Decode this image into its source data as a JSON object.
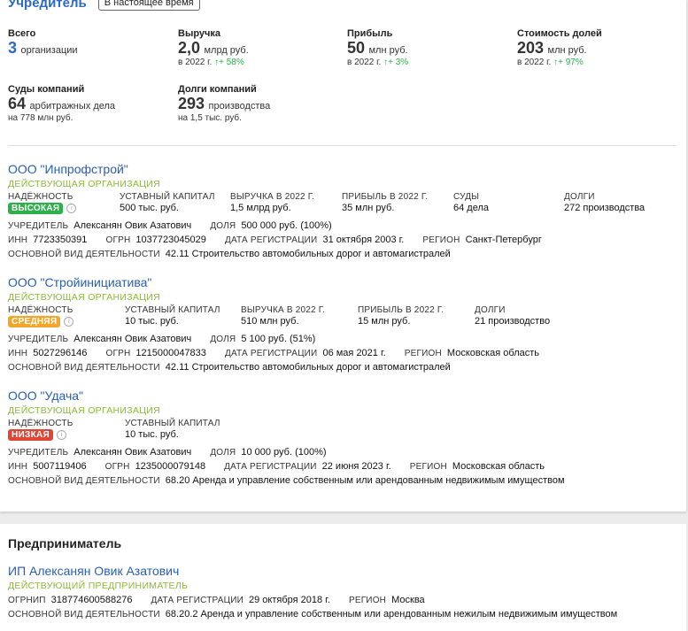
{
  "founder": {
    "title": "Учредитель",
    "badge": "В настоящее время",
    "stats": {
      "total": {
        "label": "Всего",
        "value": "3",
        "unit": "организации"
      },
      "revenue": {
        "label": "Выручка",
        "value": "2,0",
        "unit": "млрд руб.",
        "year": "в 2022 г.",
        "growth": "+ 58%"
      },
      "profit": {
        "label": "Прибыль",
        "value": "50",
        "unit": "млн руб.",
        "year": "в 2022 г.",
        "growth": "+ 3%"
      },
      "shares": {
        "label": "Стоимость долей",
        "value": "203",
        "unit": "млн руб.",
        "year": "в 2022 г.",
        "growth": "+ 97%"
      },
      "courts": {
        "label": "Суды компаний",
        "value": "64",
        "unit": "арбитражных дела",
        "sub": "на 778 млн руб."
      },
      "debts": {
        "label": "Долги компаний",
        "value": "293",
        "unit": "производства",
        "sub": "на 1,5 тыс. руб."
      }
    },
    "orgs": [
      {
        "name": "ООО \"Инпрофстрой\"",
        "status": "ДЕЙСТВУЮЩАЯ ОРГАНИЗАЦИЯ",
        "reliability_label": "НАДЁЖНОСТЬ",
        "reliability": "ВЫСОКАЯ",
        "capital_label": "УСТАВНЫЙ КАПИТАЛ",
        "capital": "500 тыс. руб.",
        "revenue_label": "ВЫРУЧКА В 2022 Г.",
        "revenue": "1,5 млрд руб.",
        "profit_label": "ПРИБЫЛЬ В 2022 Г.",
        "profit": "35 млн руб.",
        "courts_label": "СУДЫ",
        "courts": "64 дела",
        "debts_label": "ДОЛГИ",
        "debts": "272 производства",
        "founder_label": "УЧРЕДИТЕЛЬ",
        "founder": "Алексанян Овик Азатович",
        "share_label": "ДОЛЯ",
        "share": "500 000 руб. (100%)",
        "inn_label": "ИНН",
        "inn": "7723350391",
        "ogrn_label": "ОГРН",
        "ogrn": "1037723045029",
        "reg_label": "ДАТА РЕГИСТРАЦИИ",
        "reg": "31 октября 2003 г.",
        "region_label": "РЕГИОН",
        "region": "Санкт-Петербург",
        "activity_label": "ОСНОВНОЙ ВИД ДЕЯТЕЛЬНОСТИ",
        "activity": "42.11 Строительство автомобильных дорог и автомагистралей"
      },
      {
        "name": "ООО \"Стройинициатива\"",
        "status": "ДЕЙСТВУЮЩАЯ ОРГАНИЗАЦИЯ",
        "reliability_label": "НАДЁЖНОСТЬ",
        "reliability": "СРЕДНЯЯ",
        "capital_label": "УСТАВНЫЙ КАПИТАЛ",
        "capital": "10 тыс. руб.",
        "revenue_label": "ВЫРУЧКА В 2022 Г.",
        "revenue": "510 млн руб.",
        "profit_label": "ПРИБЫЛЬ В 2022 Г.",
        "profit": "15 млн руб.",
        "debts_label": "ДОЛГИ",
        "debts": "21 производство",
        "founder_label": "УЧРЕДИТЕЛЬ",
        "founder": "Алексанян Овик Азатович",
        "share_label": "ДОЛЯ",
        "share": "5 100 руб. (51%)",
        "inn_label": "ИНН",
        "inn": "5027296146",
        "ogrn_label": "ОГРН",
        "ogrn": "1215000047833",
        "reg_label": "ДАТА РЕГИСТРАЦИИ",
        "reg": "06 мая 2021 г.",
        "region_label": "РЕГИОН",
        "region": "Московская область",
        "activity_label": "ОСНОВНОЙ ВИД ДЕЯТЕЛЬНОСТИ",
        "activity": "42.11 Строительство автомобильных дорог и автомагистралей"
      },
      {
        "name": "ООО \"Удача\"",
        "status": "ДЕЙСТВУЮЩАЯ ОРГАНИЗАЦИЯ",
        "reliability_label": "НАДЁЖНОСТЬ",
        "reliability": "НИЗКАЯ",
        "capital_label": "УСТАВНЫЙ КАПИТАЛ",
        "capital": "10 тыс. руб.",
        "founder_label": "УЧРЕДИТЕЛЬ",
        "founder": "Алексанян Овик Азатович",
        "share_label": "ДОЛЯ",
        "share": "10 000 руб. (100%)",
        "inn_label": "ИНН",
        "inn": "5007119406",
        "ogrn_label": "ОГРН",
        "ogrn": "1235000079148",
        "reg_label": "ДАТА РЕГИСТРАЦИИ",
        "reg": "22 июня 2023 г.",
        "region_label": "РЕГИОН",
        "region": "Московская область",
        "activity_label": "ОСНОВНОЙ ВИД ДЕЯТЕЛЬНОСТИ",
        "activity": "68.20 Аренда и управление собственным или арендованным недвижимым имуществом"
      }
    ]
  },
  "entrepreneur": {
    "title": "Предприниматель",
    "name": "ИП Алексанян Овик Азатович",
    "status": "ДЕЙСТВУЮЩИЙ ПРЕДПРИНИМАТЕЛЬ",
    "ogrnip_label": "ОГРНИП",
    "ogrnip": "318774600588276",
    "reg_label": "ДАТА РЕГИСТРАЦИИ",
    "reg": "29 октября 2018 г.",
    "region_label": "РЕГИОН",
    "region": "Москва",
    "activity_label": "ОСНОВНОЙ ВИД ДЕЯТЕЛЬНОСТИ",
    "activity": "68.20.2 Аренда и управление собственным или арендованным нежилым недвижимым имуществом"
  },
  "colors": {
    "accent": "#2a6bc6",
    "link": "#2a5fad",
    "status": "#8cb837",
    "high": "#2bb04a",
    "medium": "#f3a72a",
    "low": "#e04636"
  },
  "icons": {
    "info": "info-icon",
    "growth": "arrow-up-icon"
  }
}
